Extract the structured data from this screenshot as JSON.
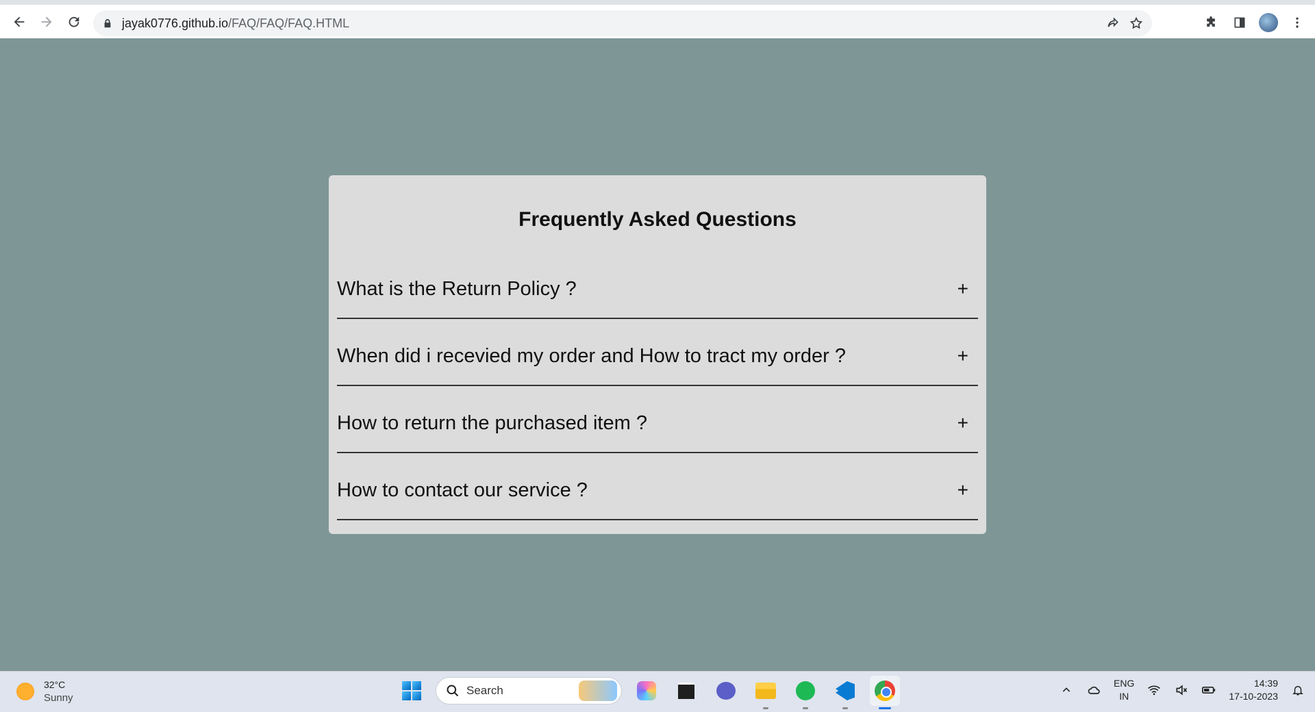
{
  "browser": {
    "url_host": "jayak0776.github.io",
    "url_path": "/FAQ/FAQ/FAQ.HTML"
  },
  "faq": {
    "title": "Frequently Asked Questions",
    "items": [
      {
        "question": "What is the Return Policy ?",
        "toggle": "+"
      },
      {
        "question": "When did i recevied my order and How to tract my order ?",
        "toggle": "+"
      },
      {
        "question": "How to return the purchased item ?",
        "toggle": "+"
      },
      {
        "question": "How to contact our service ?",
        "toggle": "+"
      }
    ]
  },
  "taskbar": {
    "weather": {
      "temp": "32°C",
      "condition": "Sunny"
    },
    "search_label": "Search",
    "language": {
      "line1": "ENG",
      "line2": "IN"
    },
    "clock": {
      "time": "14:39",
      "date": "17-10-2023"
    }
  }
}
